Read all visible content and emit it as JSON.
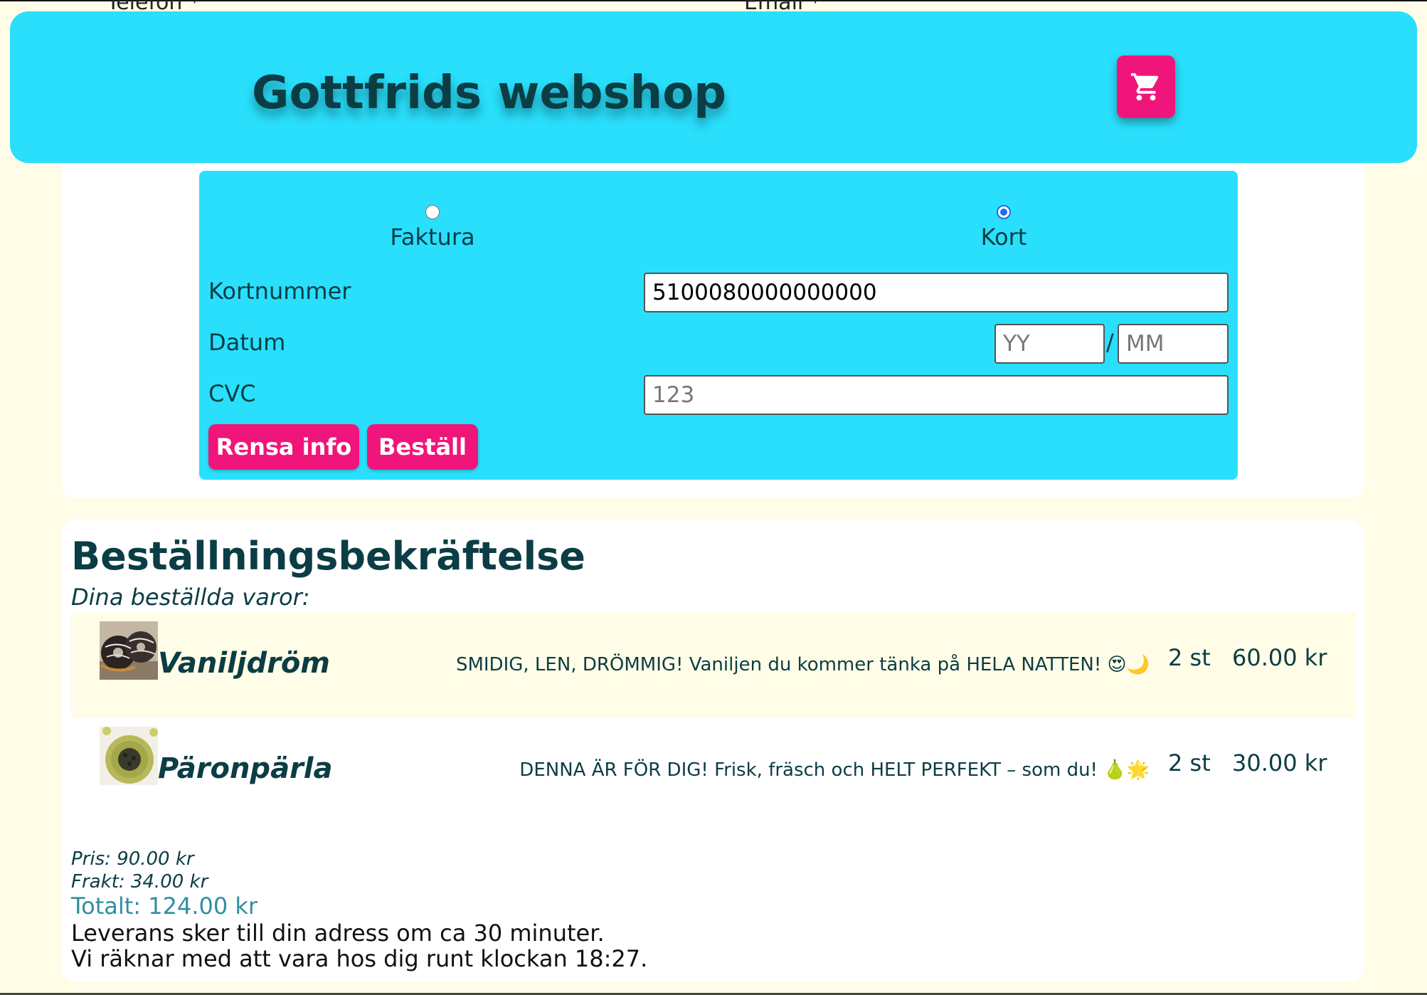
{
  "header": {
    "title": "Gottfrids webshop",
    "cart_icon": "cart-icon",
    "brand_color": "#29dffc",
    "accent_color": "#f0157a"
  },
  "peek_labels": {
    "phone": "Telefon *",
    "email": "Email *"
  },
  "payment": {
    "options": [
      {
        "label": "Faktura",
        "checked": false
      },
      {
        "label": "Kort",
        "checked": true
      }
    ],
    "card_number_label": "Kortnummer",
    "card_number_value": "5100080000000000",
    "date_label": "Datum",
    "year_placeholder": "YY",
    "month_placeholder": "MM",
    "date_separator": "/",
    "cvc_label": "CVC",
    "cvc_placeholder": "123",
    "clear_button": "Rensa info",
    "order_button": "Beställ"
  },
  "confirmation": {
    "title": "Beställningsbekräftelse",
    "subtitle": "Dina beställda varor:",
    "items": [
      {
        "name": "Vaniljdröm",
        "description": "SMIDIG, LEN, DRÖMMIG! Vaniljen du kommer tänka på HELA NATTEN! 😍🌙",
        "quantity": "2 st",
        "price": "60.00 kr"
      },
      {
        "name": "Päronpärla",
        "description": "DENNA ÄR FÖR DIG! Frisk, fräsch och HELT PERFEKT – som du! 🍐🌟",
        "quantity": "2 st",
        "price": "30.00 kr"
      }
    ],
    "price": "Pris: 90.00 kr",
    "shipping": "Frakt: 34.00 kr",
    "total": "Totalt: 124.00 kr",
    "delivery": "Leverans sker till din adress om ca 30 minuter.",
    "eta": "Vi räknar med att vara hos dig runt klockan 18:27."
  }
}
